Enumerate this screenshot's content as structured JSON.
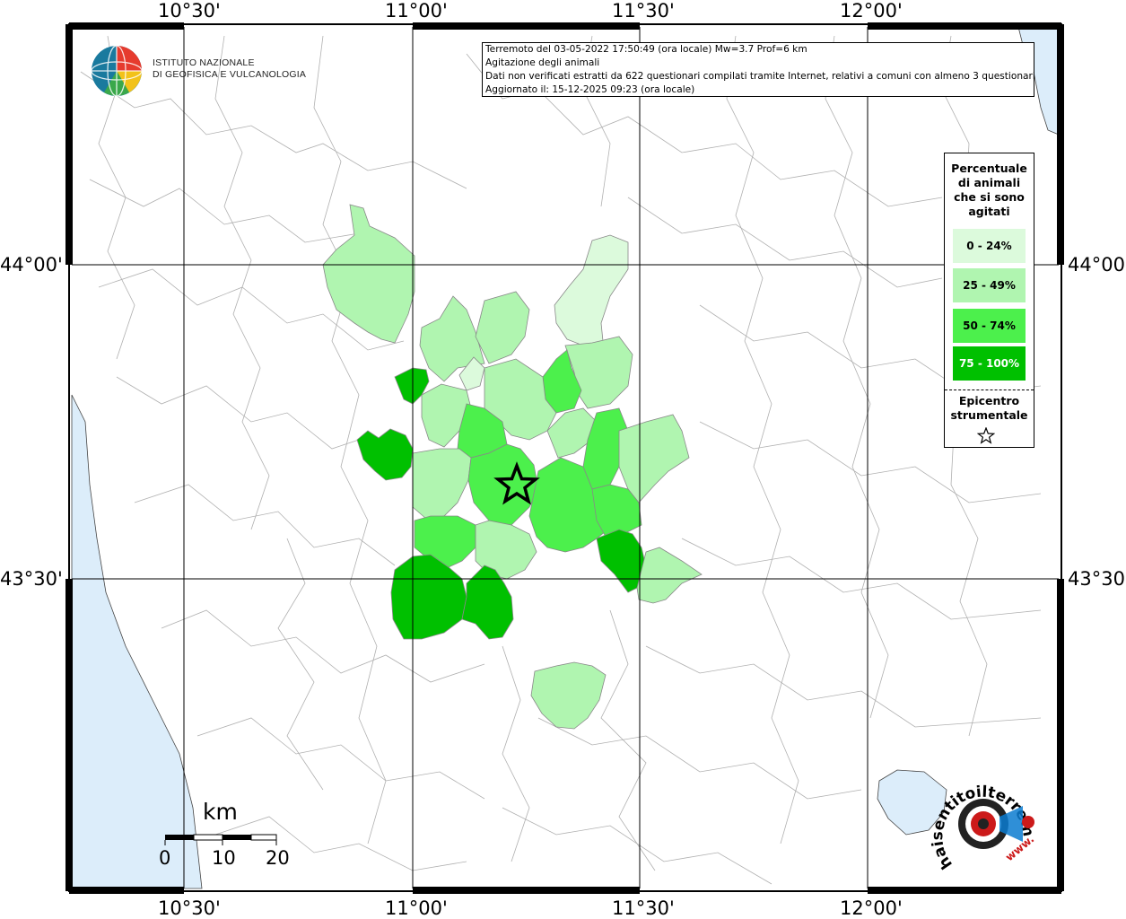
{
  "header": {
    "line1": "Terremoto del 03-05-2022 17:50:49 (ora locale) Mw=3.7 Prof=6 km",
    "line2": "Agitazione degli animali",
    "line3": "Dati non verificati estratti da 622 questionari compilati tramite Internet, relativi a comuni con almeno 3 questionari.",
    "line4": "Aggiornato il: 15-12-2025 09:23 (ora locale)"
  },
  "logo": {
    "line1": "ISTITUTO NAZIONALE",
    "line2": "DI GEOFISICA E VULCANOLOGIA"
  },
  "axes": {
    "top": [
      "10°30'",
      "11°00'",
      "11°30'",
      "12°00'"
    ],
    "bottom": [
      "10°30'",
      "11°00'",
      "11°30'",
      "12°00'"
    ],
    "left": [
      "44°00'",
      "43°30'"
    ],
    "right": [
      "44°00'",
      "43°30'"
    ]
  },
  "legend": {
    "title_lines": [
      "Percentuale",
      "di animali",
      "che si sono",
      "agitati"
    ],
    "items": [
      {
        "label": "0 - 24%",
        "color": "#dcfadc"
      },
      {
        "label": "25 - 49%",
        "color": "#b0f5b0"
      },
      {
        "label": "50 - 74%",
        "color": "#4cf04c"
      },
      {
        "label": "75 - 100%",
        "color": "#00c000"
      }
    ],
    "epicenter_lines": [
      "Epicentro",
      "strumentale"
    ]
  },
  "scale": {
    "unit": "km",
    "labels": [
      "0",
      "10",
      "20"
    ]
  },
  "brand": {
    "text": "haisentitoilterremoto.it",
    "url_text": "www."
  },
  "colors": {
    "sea": "#dcedfa",
    "frame": "#000000",
    "class_0_24": "#dcfadc",
    "class_25_49": "#b0f5b0",
    "class_50_74": "#4cf04c",
    "class_75_100": "#00c000"
  },
  "epicenter": {
    "lat": "43°33'",
    "lon": "11°14'"
  }
}
